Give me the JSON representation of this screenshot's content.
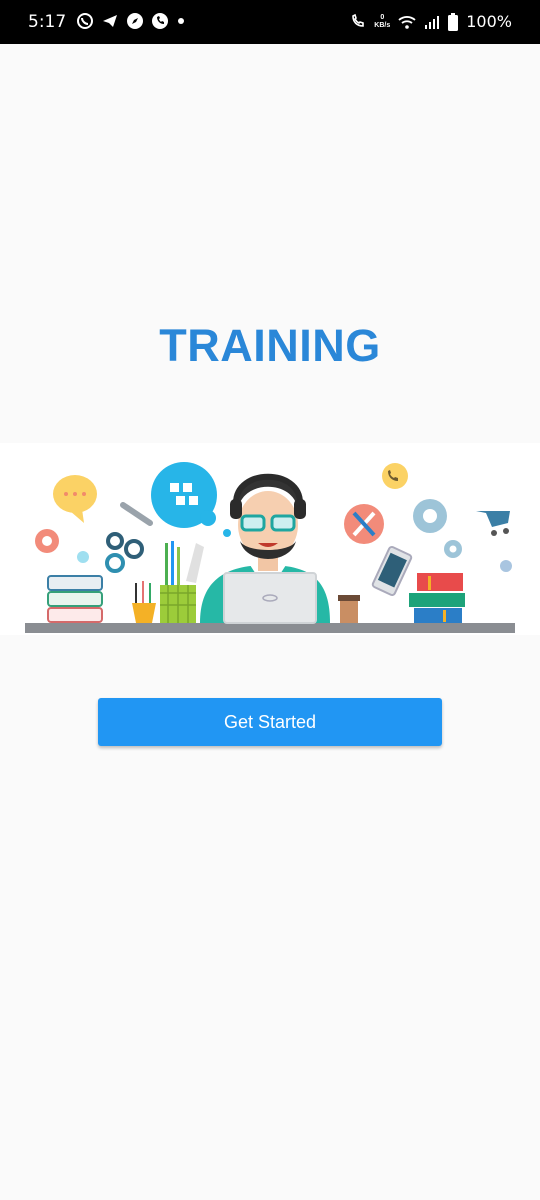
{
  "status_bar": {
    "time": "5:17",
    "left_icons": [
      "whatsapp-icon",
      "telegram-icon",
      "compass-icon",
      "phone-app-icon",
      "dot-icon"
    ],
    "data_speed_value": "0",
    "data_speed_unit": "KB/s",
    "battery": "100%"
  },
  "main": {
    "title": "TRAINING",
    "button_label": "Get Started"
  },
  "colors": {
    "title": "#2a87d8",
    "button": "#2196f3",
    "background": "#fafafa"
  }
}
